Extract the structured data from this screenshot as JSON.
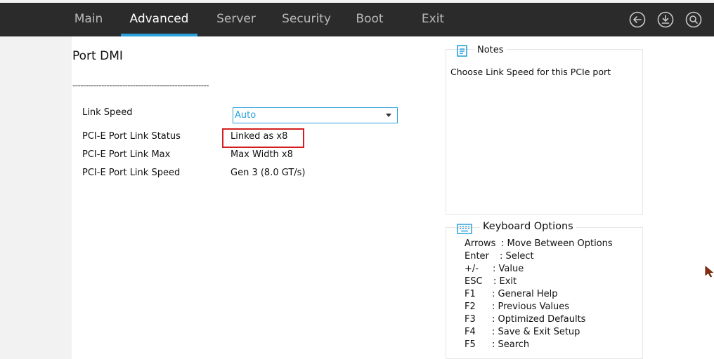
{
  "nav": {
    "tabs": [
      {
        "label": "Main"
      },
      {
        "label": "Advanced"
      },
      {
        "label": "Server"
      },
      {
        "label": "Security"
      },
      {
        "label": "Boot"
      },
      {
        "label": "Exit"
      }
    ],
    "active_tab": "Advanced",
    "icons": [
      "back-icon",
      "save-download-icon",
      "search-icon"
    ]
  },
  "page": {
    "title": "Port DMI",
    "rule": "----------------------------------------------------"
  },
  "settings": {
    "link_speed": {
      "label": "Link Speed",
      "value": "Auto"
    },
    "link_status": {
      "label": "PCI-E Port Link Status",
      "value": "Linked as x8"
    },
    "link_max": {
      "label": "PCI-E Port Link Max",
      "value": "Max Width x8"
    },
    "link_speed_current": {
      "label": "PCI-E Port Link Speed",
      "value": "Gen 3 (8.0 GT/s)"
    }
  },
  "notes": {
    "title": "Notes",
    "text": "Choose Link Speed for this PCIe port"
  },
  "keyboard": {
    "title": "Keyboard Options",
    "lines": [
      {
        "key": "Arrows",
        "desc": ": Move Between Options"
      },
      {
        "key": "Enter",
        "desc": ": Select"
      },
      {
        "key": "+/-",
        "desc": ": Value"
      },
      {
        "key": "ESC",
        "desc": ": Exit"
      },
      {
        "key": "F1",
        "desc": ": General Help"
      },
      {
        "key": "F2",
        "desc": ": Previous Values"
      },
      {
        "key": "F3",
        "desc": ": Optimized Defaults"
      },
      {
        "key": "F4",
        "desc": ": Save & Exit Setup"
      },
      {
        "key": "F5",
        "desc": ": Search"
      }
    ]
  },
  "colors": {
    "topbar_bg": "#2b2b2b",
    "accent": "#2aa0dd",
    "highlight_border": "#d21e1e",
    "cursor": "#8b2a0e"
  }
}
